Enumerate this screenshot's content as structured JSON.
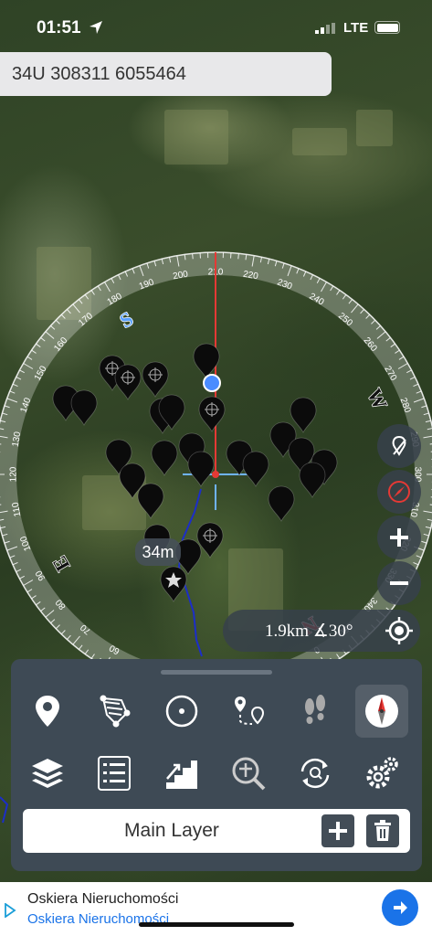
{
  "status_bar": {
    "time": "01:51",
    "network": "LTE",
    "icons": [
      "location-arrow-icon",
      "signal-icon",
      "battery-icon"
    ]
  },
  "coordinates": "34U 308311 6055464",
  "compass": {
    "degree_labels": [
      "210",
      "220",
      "230",
      "240",
      "250",
      "260",
      "270",
      "280",
      "290",
      "300",
      "310",
      "320",
      "330",
      "340",
      "350",
      "0",
      "10",
      "20",
      "30",
      "40",
      "50",
      "60",
      "70",
      "80",
      "90",
      "100",
      "110",
      "120",
      "130",
      "140",
      "150",
      "160",
      "170",
      "180",
      "190",
      "200"
    ],
    "cardinals": {
      "north": "N",
      "east": "E",
      "south": "S",
      "west": "W"
    }
  },
  "distance_label": "34m",
  "scale": {
    "distance": "1.9km",
    "angle": "∡30°"
  },
  "side_buttons": [
    "route-edit-icon",
    "compass-needle-icon",
    "zoom-in-icon",
    "zoom-out-icon",
    "locate-icon"
  ],
  "toolbar": {
    "row1": [
      "place-marker-icon",
      "track-area-icon",
      "circle-point-icon",
      "route-icon",
      "footprints-icon",
      "compass-icon"
    ],
    "row2": [
      "layers-icon",
      "list-icon",
      "stairs-icon",
      "zoom-pin-icon",
      "sync-icon",
      "settings-icon"
    ],
    "active": "compass-icon"
  },
  "layer": {
    "name": "Main Layer"
  },
  "ad": {
    "title": "Oskiera Nieruchomości",
    "subtitle": "Oskiera Nieruchomości"
  },
  "colors": {
    "panel": "#3e4a55",
    "accent_red": "#e53935",
    "accent_blue": "#1a73e8",
    "track_blue": "#1c2ec8"
  }
}
